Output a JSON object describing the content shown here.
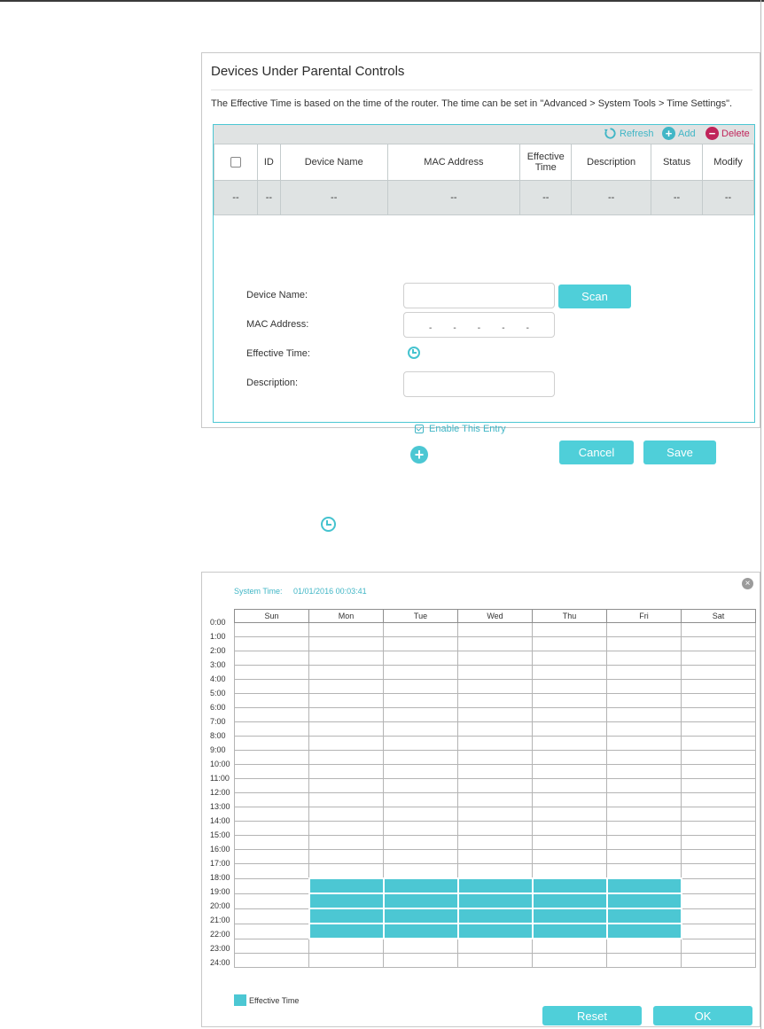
{
  "panel1": {
    "title": "Devices Under Parental Controls",
    "note": "The Effective Time is based on the time of the router. The time can be set in \"Advanced > System Tools > Time Settings\".",
    "toolbar": {
      "refresh": "Refresh",
      "add": "Add",
      "delete": "Delete"
    },
    "columns": [
      "ID",
      "Device Name",
      "MAC Address",
      "Effective Time",
      "Description",
      "Status",
      "Modify"
    ],
    "empty_row": [
      "--",
      "--",
      "--",
      "--",
      "--",
      "--",
      "--",
      "--"
    ],
    "form": {
      "device_name_label": "Device Name:",
      "device_name_value": "",
      "mac_label": "MAC Address:",
      "mac_separators": [
        "-",
        "-",
        "-",
        "-",
        "-"
      ],
      "effective_time_label": "Effective Time:",
      "description_label": "Description:",
      "description_value": "",
      "scan": "Scan",
      "enable_entry": "Enable This Entry",
      "enable_checked": true,
      "cancel": "Cancel",
      "save": "Save"
    }
  },
  "panel2": {
    "system_time_label": "System Time:",
    "system_time_value": "01/01/2016 00:03:41",
    "days": [
      "Sun",
      "Mon",
      "Tue",
      "Wed",
      "Thu",
      "Fri",
      "Sat"
    ],
    "hours": [
      "0:00",
      "1:00",
      "2:00",
      "3:00",
      "4:00",
      "5:00",
      "6:00",
      "7:00",
      "8:00",
      "9:00",
      "10:00",
      "11:00",
      "12:00",
      "13:00",
      "14:00",
      "15:00",
      "16:00",
      "17:00",
      "18:00",
      "19:00",
      "20:00",
      "21:00",
      "22:00",
      "23:00",
      "24:00"
    ],
    "selected": {
      "days": [
        "Mon",
        "Tue",
        "Wed",
        "Thu",
        "Fri"
      ],
      "from_hour": 18,
      "to_hour": 22
    },
    "legend": "Effective Time",
    "reset": "Reset",
    "ok": "OK"
  },
  "colors": {
    "accent": "#4cc7d3",
    "delete": "#c0245a",
    "toolbar_bg": "#e0e3e3"
  },
  "icons": [
    "refresh-icon",
    "add-icon",
    "delete-icon",
    "clock-icon",
    "close-icon"
  ]
}
